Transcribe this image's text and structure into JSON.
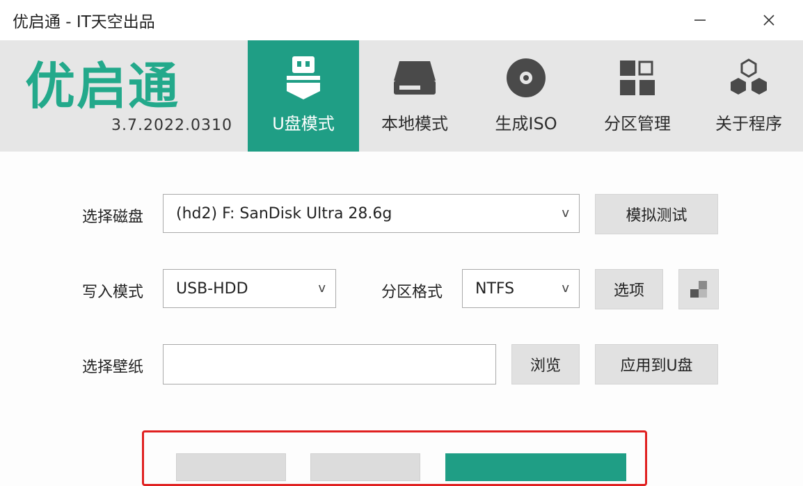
{
  "window": {
    "title": "优启通 - IT天空出品"
  },
  "brand": {
    "name": "优启通",
    "version": "3.7.2022.0310",
    "accent": "#23a98b"
  },
  "tabs": [
    {
      "label": "U盘模式",
      "icon": "usb-drive-icon",
      "active": true
    },
    {
      "label": "本地模式",
      "icon": "hard-disk-icon",
      "active": false
    },
    {
      "label": "生成ISO",
      "icon": "disc-icon",
      "active": false
    },
    {
      "label": "分区管理",
      "icon": "partition-grid-icon",
      "active": false
    },
    {
      "label": "关于程序",
      "icon": "hexagons-icon",
      "active": false
    }
  ],
  "form": {
    "disk": {
      "label": "选择磁盘",
      "value": "(hd2) F: SanDisk Ultra 28.6g",
      "test_button": "模拟测试"
    },
    "write_mode": {
      "label": "写入模式",
      "value": "USB-HDD"
    },
    "partition_format": {
      "label": "分区格式",
      "value": "NTFS",
      "options_button": "选项"
    },
    "wallpaper": {
      "label": "选择壁纸",
      "value": "",
      "browse_button": "浏览",
      "apply_button": "应用到U盘"
    }
  },
  "colors": {
    "active_tab": "#1f9e85",
    "highlight_box": "#e02020"
  }
}
